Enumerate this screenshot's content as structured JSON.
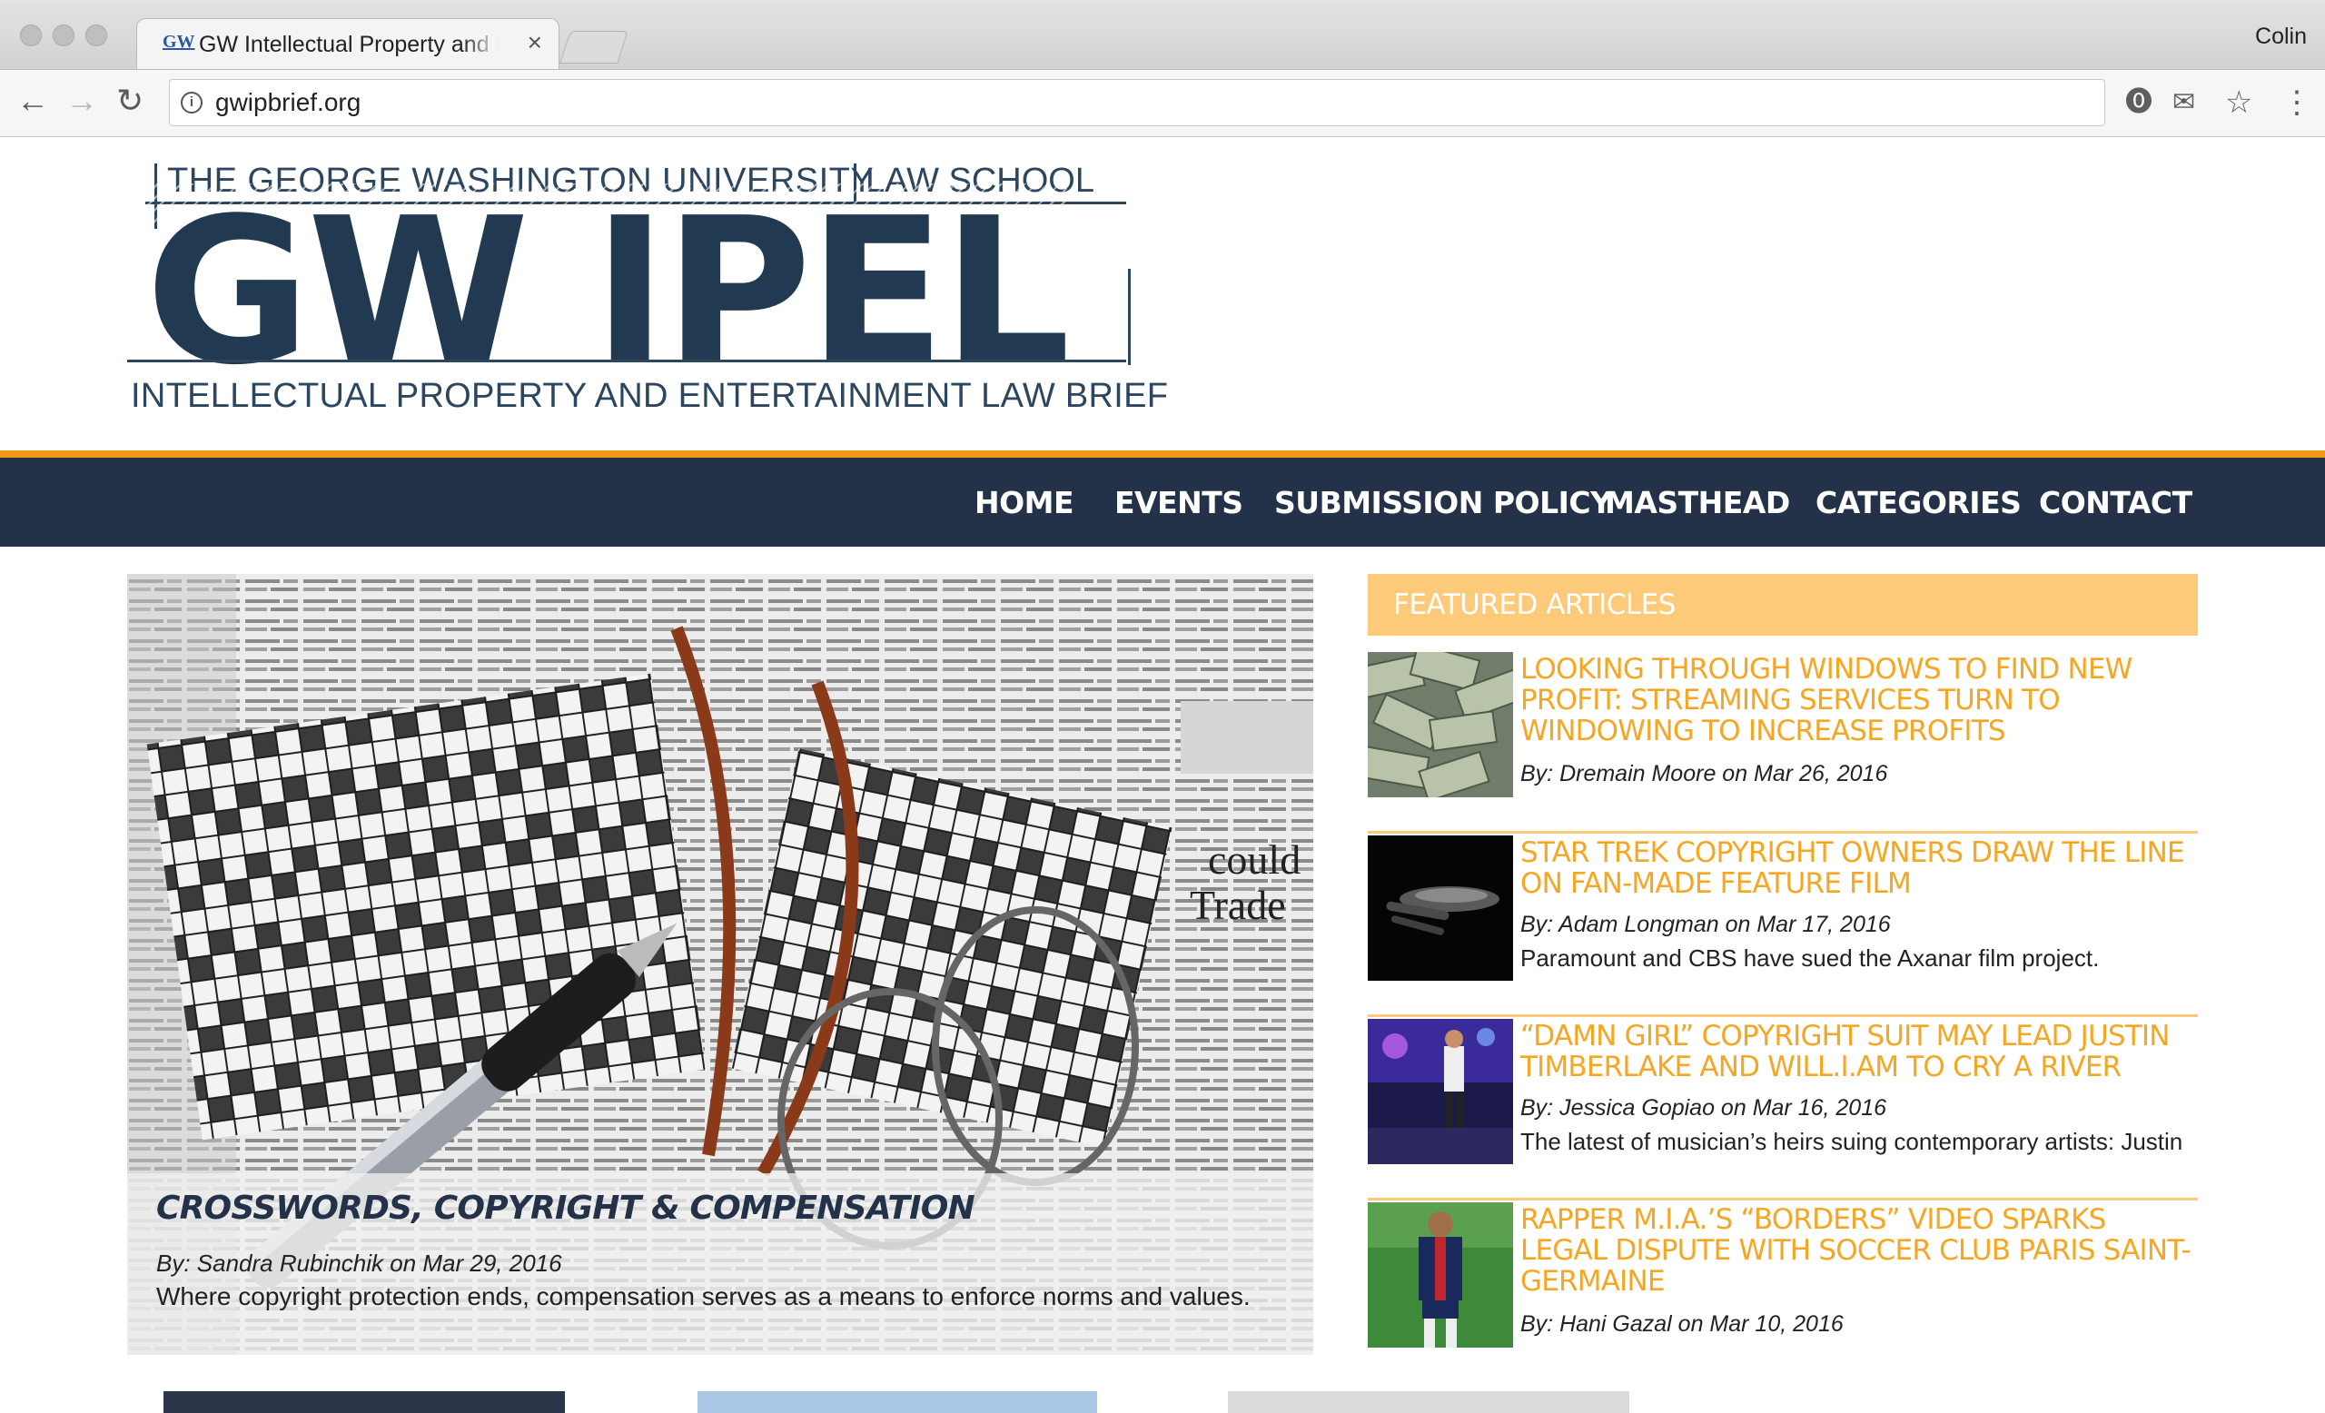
{
  "browser": {
    "tab_favicon": "GW",
    "tab_title": "GW Intellectual Property and Entertainment Law Brief",
    "tab_close": "×",
    "profile_name": "Colin",
    "url": "gwipbrief.org",
    "icons": {
      "back": "back-arrow-icon",
      "forward": "forward-arrow-icon",
      "reload": "reload-icon",
      "info": "info-icon",
      "extension1": "extension-icon",
      "extension2": "mail-extension-icon",
      "star": "bookmark-star-icon",
      "menu": "kebab-menu-icon"
    }
  },
  "site": {
    "logo_top_left": "THE GEORGE WASHINGTON UNIVERSITY",
    "logo_top_right": "LAW SCHOOL",
    "logo_main": "GW IPEL",
    "logo_sub": "INTELLECTUAL PROPERTY AND ENTERTAINMENT LAW BRIEF",
    "colors": {
      "navy": "#243249",
      "orange": "#f09b14",
      "featured_orange": "#f5a623",
      "featured_bar": "#fdca7a"
    }
  },
  "nav": {
    "items": [
      "HOME",
      "EVENTS",
      "SUBMISSION POLICY",
      "MASTHEAD",
      "CATEGORIES",
      "CONTACT"
    ]
  },
  "hero": {
    "title": "CROSSWORDS, COPYRIGHT & COMPENSATION",
    "byline": "By: Sandra Rubinchik on Mar 29, 2016",
    "excerpt": "Where copyright protection ends, compensation serves as a means to enforce norms and values.",
    "image": "newspaper-crossword-glasses-pen"
  },
  "featured": {
    "heading": "FEATURED ARTICLES",
    "articles": [
      {
        "title": "LOOKING THROUGH WINDOWS TO FIND NEW PROFIT: STREAMING SERVICES TURN TO WINDOWING TO INCREASE PROFITS",
        "byline": "By: Dremain Moore on Mar 26, 2016",
        "excerpt": "",
        "thumb": "money-stack-thumbnail"
      },
      {
        "title": "STAR TREK COPYRIGHT OWNERS DRAW THE LINE ON FAN-MADE FEATURE FILM",
        "byline": "By: Adam Longman on Mar 17, 2016",
        "excerpt": "Paramount and CBS have sued the Axanar film project.",
        "thumb": "starship-thumbnail"
      },
      {
        "title": "“DAMN GIRL” COPYRIGHT SUIT MAY LEAD JUSTIN TIMBERLAKE AND WILL.I.AM TO CRY A RIVER",
        "byline": "By: Jessica Gopiao on Mar 16, 2016",
        "excerpt": "The latest of musician’s heirs suing contemporary artists: Justin",
        "thumb": "concert-stage-thumbnail"
      },
      {
        "title": "RAPPER M.I.A.’S “BORDERS” VIDEO SPARKS LEGAL DISPUTE WITH SOCCER CLUB PARIS SAINT-GERMAINE",
        "byline": "By: Hani Gazal on Mar 10, 2016",
        "excerpt": "",
        "thumb": "soccer-player-thumbnail"
      }
    ]
  }
}
